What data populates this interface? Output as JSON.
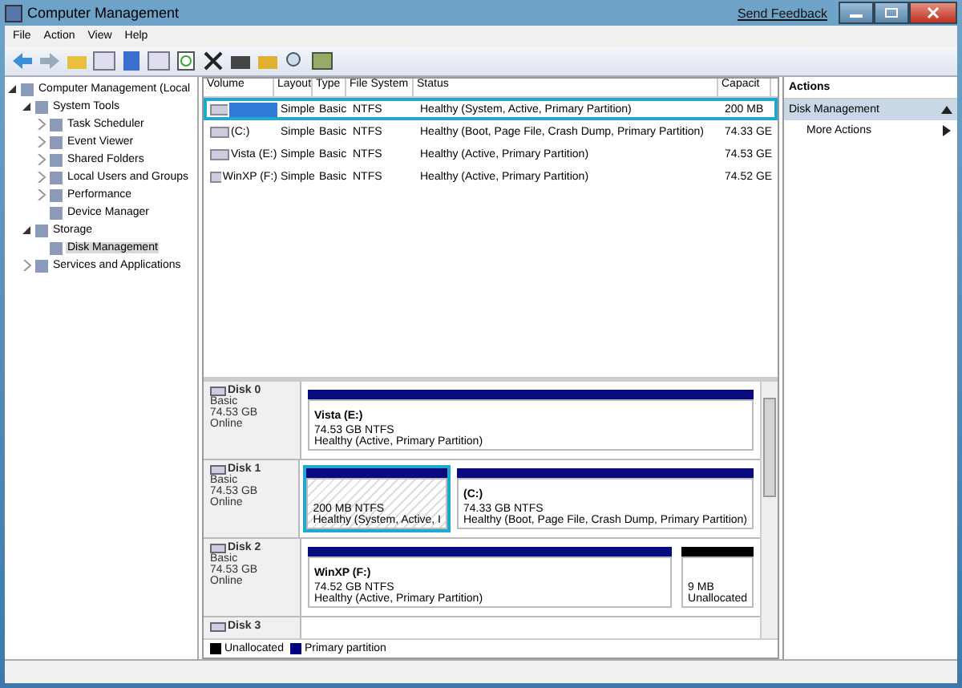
{
  "window": {
    "title": "Computer Management",
    "feedback_link": "Send Feedback"
  },
  "menu": [
    "File",
    "Action",
    "View",
    "Help"
  ],
  "tree": [
    {
      "label": "Computer Management (Local",
      "expanded": true,
      "selected": false,
      "children": [
        {
          "label": "System Tools",
          "expanded": true,
          "selected": false,
          "children": [
            {
              "label": "Task Scheduler",
              "expanded": false,
              "selected": false
            },
            {
              "label": "Event Viewer",
              "expanded": false,
              "selected": false
            },
            {
              "label": "Shared Folders",
              "expanded": false,
              "selected": false
            },
            {
              "label": "Local Users and Groups",
              "expanded": false,
              "selected": false
            },
            {
              "label": "Performance",
              "expanded": false,
              "selected": false
            },
            {
              "label": "Device Manager",
              "selected": false
            }
          ]
        },
        {
          "label": "Storage",
          "expanded": true,
          "selected": false,
          "children": [
            {
              "label": "Disk Management",
              "selected": true
            }
          ]
        },
        {
          "label": "Services and Applications",
          "expanded": false,
          "selected": false
        }
      ]
    }
  ],
  "table": {
    "columns": [
      "Volume",
      "Layout",
      "Type",
      "File System",
      "Status",
      "Capacit"
    ],
    "rows": [
      {
        "layout": "Simple",
        "type": "Basic",
        "file_system": "NTFS",
        "status": "Healthy (System, Active, Primary Partition)",
        "capacity": "200 MB",
        "selected": true
      },
      {
        "volume": "(C:)",
        "layout": "Simple",
        "type": "Basic",
        "file_system": "NTFS",
        "status": "Healthy (Boot, Page File, Crash Dump, Primary Partition)",
        "capacity": "74.33 GE",
        "selected": false
      },
      {
        "volume": "Vista (E:)",
        "layout": "Simple",
        "type": "Basic",
        "file_system": "NTFS",
        "status": "Healthy (Active, Primary Partition)",
        "capacity": "74.53 GE",
        "selected": false
      },
      {
        "volume": "WinXP (F:)",
        "layout": "Simple",
        "type": "Basic",
        "file_system": "NTFS",
        "status": "Healthy (Active, Primary Partition)",
        "capacity": "74.52 GE",
        "selected": false
      }
    ]
  },
  "disks": [
    {
      "name": "Disk 0",
      "type": "Basic",
      "size": "74.53 GB",
      "state": "Online",
      "partitions": [
        {
          "kind": "primary",
          "selected": false,
          "title": "Vista  (E:)",
          "size": "74.53 GB NTFS",
          "status": "Healthy (Active, Primary Partition)"
        }
      ]
    },
    {
      "name": "Disk 1",
      "type": "Basic",
      "size": "74.53 GB",
      "state": "Online",
      "partitions": [
        {
          "kind": "primary",
          "selected": true,
          "size": "200 MB NTFS",
          "status": "Healthy (System, Active, I"
        },
        {
          "kind": "primary",
          "selected": false,
          "title": "(C:)",
          "size": "74.33 GB NTFS",
          "status": "Healthy (Boot, Page File, Crash Dump, Primary Partition)"
        }
      ]
    },
    {
      "name": "Disk 2",
      "type": "Basic",
      "size": "74.53 GB",
      "state": "Online",
      "partitions": [
        {
          "kind": "primary",
          "selected": false,
          "title": "WinXP  (F:)",
          "size": "74.52 GB NTFS",
          "status": "Healthy (Active, Primary Partition)"
        },
        {
          "kind": "unallocated",
          "selected": false,
          "size": "9 MB",
          "status": "Unallocated"
        }
      ]
    },
    {
      "name": "Disk 3"
    }
  ],
  "legend": [
    {
      "label": "Unallocated",
      "color": "#000000"
    },
    {
      "label": "Primary partition",
      "color": "#000080"
    }
  ],
  "actions": {
    "title": "Actions",
    "section": "Disk Management",
    "items": [
      "More Actions"
    ]
  }
}
